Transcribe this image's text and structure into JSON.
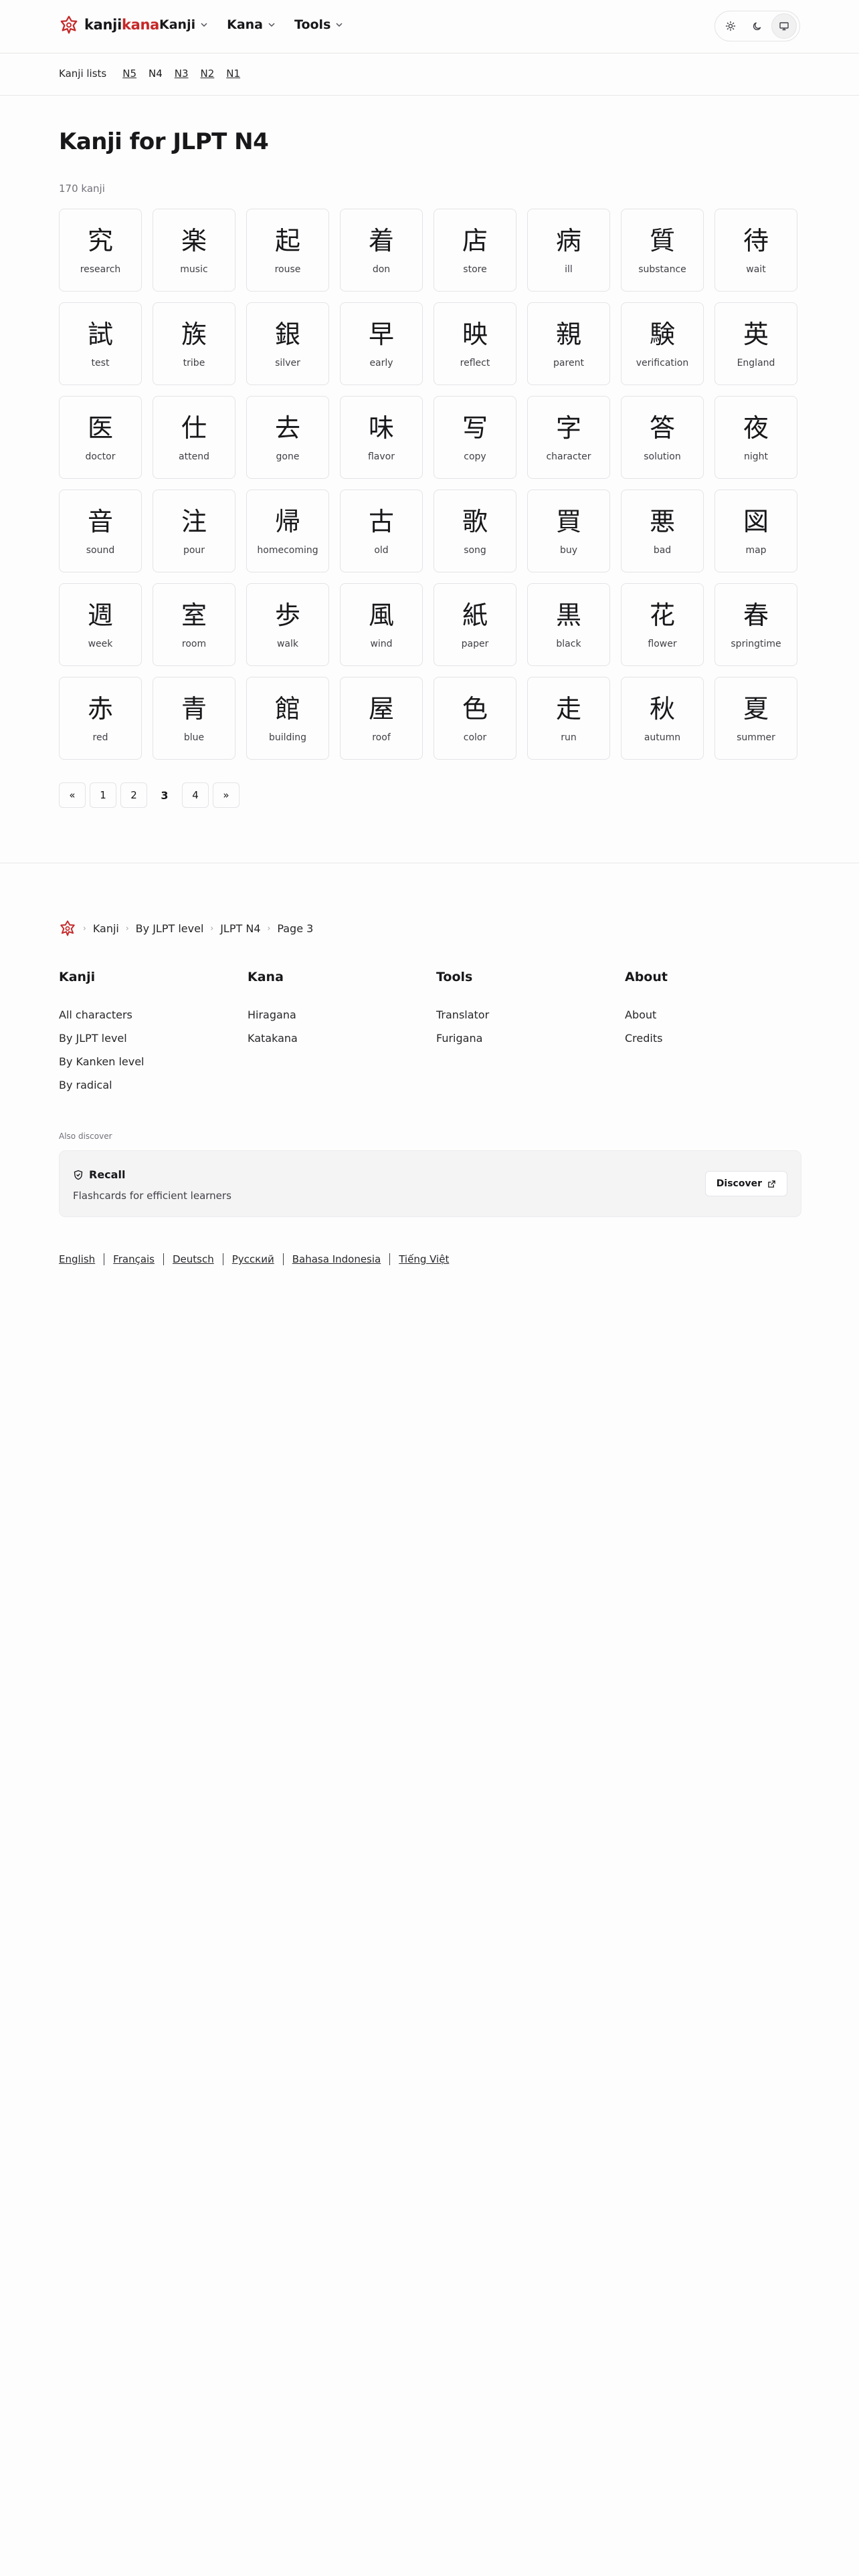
{
  "header": {
    "logo_text_a": "kanji",
    "logo_text_b": "kana",
    "nav": [
      {
        "label": "Kanji"
      },
      {
        "label": "Kana"
      },
      {
        "label": "Tools"
      }
    ],
    "theme_icons": [
      "sun-icon",
      "moon-icon",
      "monitor-icon"
    ]
  },
  "subnav": {
    "title": "Kanji lists",
    "levels": [
      "N5",
      "N4",
      "N3",
      "N2",
      "N1"
    ],
    "current": "N4"
  },
  "main": {
    "title": "Kanji for JLPT N4",
    "count": "170 kanji",
    "kanji": [
      {
        "char": "究",
        "meaning": "research"
      },
      {
        "char": "楽",
        "meaning": "music"
      },
      {
        "char": "起",
        "meaning": "rouse"
      },
      {
        "char": "着",
        "meaning": "don"
      },
      {
        "char": "店",
        "meaning": "store"
      },
      {
        "char": "病",
        "meaning": "ill"
      },
      {
        "char": "質",
        "meaning": "substance"
      },
      {
        "char": "待",
        "meaning": "wait"
      },
      {
        "char": "試",
        "meaning": "test"
      },
      {
        "char": "族",
        "meaning": "tribe"
      },
      {
        "char": "銀",
        "meaning": "silver"
      },
      {
        "char": "早",
        "meaning": "early"
      },
      {
        "char": "映",
        "meaning": "reflect"
      },
      {
        "char": "親",
        "meaning": "parent"
      },
      {
        "char": "験",
        "meaning": "verification"
      },
      {
        "char": "英",
        "meaning": "England"
      },
      {
        "char": "医",
        "meaning": "doctor"
      },
      {
        "char": "仕",
        "meaning": "attend"
      },
      {
        "char": "去",
        "meaning": "gone"
      },
      {
        "char": "味",
        "meaning": "flavor"
      },
      {
        "char": "写",
        "meaning": "copy"
      },
      {
        "char": "字",
        "meaning": "character"
      },
      {
        "char": "答",
        "meaning": "solution"
      },
      {
        "char": "夜",
        "meaning": "night"
      },
      {
        "char": "音",
        "meaning": "sound"
      },
      {
        "char": "注",
        "meaning": "pour"
      },
      {
        "char": "帰",
        "meaning": "homecoming"
      },
      {
        "char": "古",
        "meaning": "old"
      },
      {
        "char": "歌",
        "meaning": "song"
      },
      {
        "char": "買",
        "meaning": "buy"
      },
      {
        "char": "悪",
        "meaning": "bad"
      },
      {
        "char": "図",
        "meaning": "map"
      },
      {
        "char": "週",
        "meaning": "week"
      },
      {
        "char": "室",
        "meaning": "room"
      },
      {
        "char": "歩",
        "meaning": "walk"
      },
      {
        "char": "風",
        "meaning": "wind"
      },
      {
        "char": "紙",
        "meaning": "paper"
      },
      {
        "char": "黒",
        "meaning": "black"
      },
      {
        "char": "花",
        "meaning": "flower"
      },
      {
        "char": "春",
        "meaning": "springtime"
      },
      {
        "char": "赤",
        "meaning": "red"
      },
      {
        "char": "青",
        "meaning": "blue"
      },
      {
        "char": "館",
        "meaning": "building"
      },
      {
        "char": "屋",
        "meaning": "roof"
      },
      {
        "char": "色",
        "meaning": "color"
      },
      {
        "char": "走",
        "meaning": "run"
      },
      {
        "char": "秋",
        "meaning": "autumn"
      },
      {
        "char": "夏",
        "meaning": "summer"
      }
    ],
    "pagination": {
      "prev": "«",
      "pages": [
        "1",
        "2",
        "3",
        "4"
      ],
      "current": "3",
      "next": "»"
    }
  },
  "footer": {
    "breadcrumb": [
      "Kanji",
      "By JLPT level",
      "JLPT N4",
      "Page 3"
    ],
    "columns": [
      {
        "title": "Kanji",
        "links": [
          "All characters",
          "By JLPT level",
          "By Kanken level",
          "By radical"
        ]
      },
      {
        "title": "Kana",
        "links": [
          "Hiragana",
          "Katakana"
        ]
      },
      {
        "title": "Tools",
        "links": [
          "Translator",
          "Furigana"
        ]
      },
      {
        "title": "About",
        "links": [
          "About",
          "Credits"
        ]
      }
    ],
    "also_discover": "Also discover",
    "recall": {
      "name": "Recall",
      "description": "Flashcards for efficient learners",
      "button": "Discover"
    },
    "languages": [
      "English",
      "Français",
      "Deutsch",
      "Русский",
      "Bahasa Indonesia",
      "Tiếng Việt"
    ]
  },
  "colors": {
    "brand": "#c62828",
    "text": "#18181b",
    "border": "#e4e4e7",
    "muted": "#71717a"
  }
}
